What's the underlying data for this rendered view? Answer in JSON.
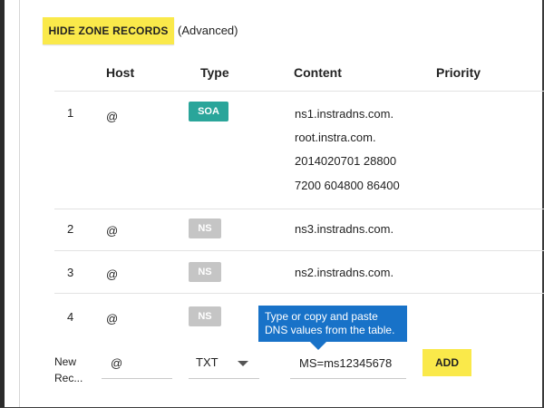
{
  "toolbar": {
    "hide_zone_records_label": "HIDE ZONE RECORDS",
    "advanced_label": "(Advanced)"
  },
  "table": {
    "headers": {
      "host": "Host",
      "type": "Type",
      "content": "Content",
      "priority": "Priority"
    },
    "rows": [
      {
        "index": "1",
        "host": "@",
        "type": "SOA",
        "content": [
          "ns1.instradns.com.",
          "root.instra.com.",
          "2014020701 28800",
          "7200 604800 86400"
        ]
      },
      {
        "index": "2",
        "host": "@",
        "type": "NS",
        "content": [
          "ns3.instradns.com."
        ]
      },
      {
        "index": "3",
        "host": "@",
        "type": "NS",
        "content": [
          "ns2.instradns.com."
        ]
      },
      {
        "index": "4",
        "host": "@",
        "type": "NS",
        "content": []
      }
    ]
  },
  "new_record": {
    "label_line1": "New",
    "label_line2": "Rec...",
    "host_value": "@",
    "type_value": "TXT",
    "content_value": "MS=ms12345678",
    "add_label": "ADD"
  },
  "tooltip": {
    "text": "Type or copy and paste DNS values from the table."
  },
  "colors": {
    "button_yellow": "#fae94a",
    "soa_badge": "#2aa59a",
    "ns_badge": "#c5c5c5",
    "tooltip_blue": "#1872c8"
  }
}
